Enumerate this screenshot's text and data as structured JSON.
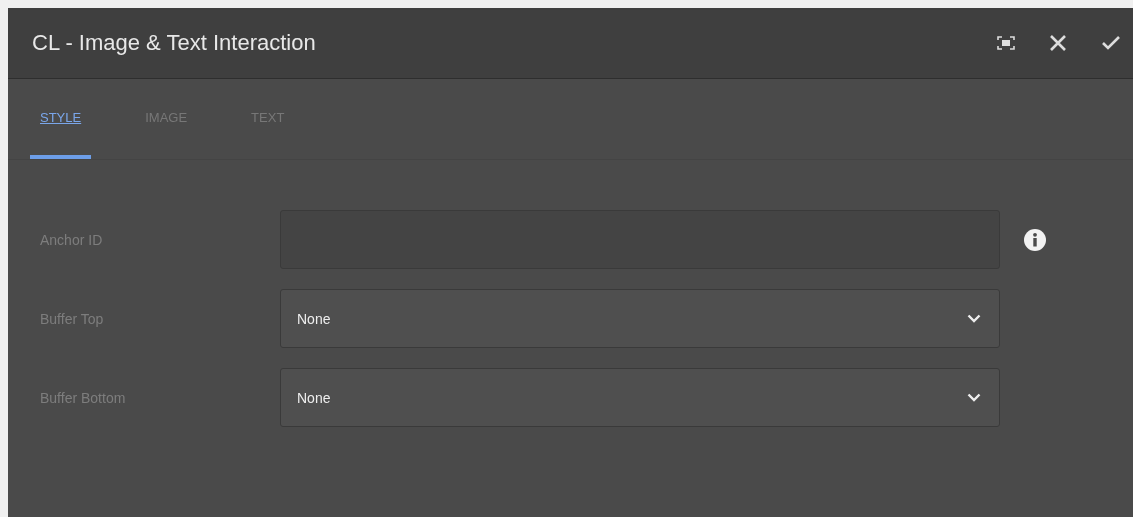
{
  "window": {
    "title": "CL - Image & Text Interaction"
  },
  "tabs": [
    {
      "label": "STYLE",
      "selected": true
    },
    {
      "label": "IMAGE",
      "selected": false
    },
    {
      "label": "TEXT",
      "selected": false
    }
  ],
  "fields": [
    {
      "kind": "text",
      "label": "Anchor ID",
      "info": true
    },
    {
      "kind": "select",
      "label": "Buffer Top",
      "value": "None"
    },
    {
      "kind": "select",
      "label": "Buffer Bottom",
      "value": "None"
    }
  ]
}
